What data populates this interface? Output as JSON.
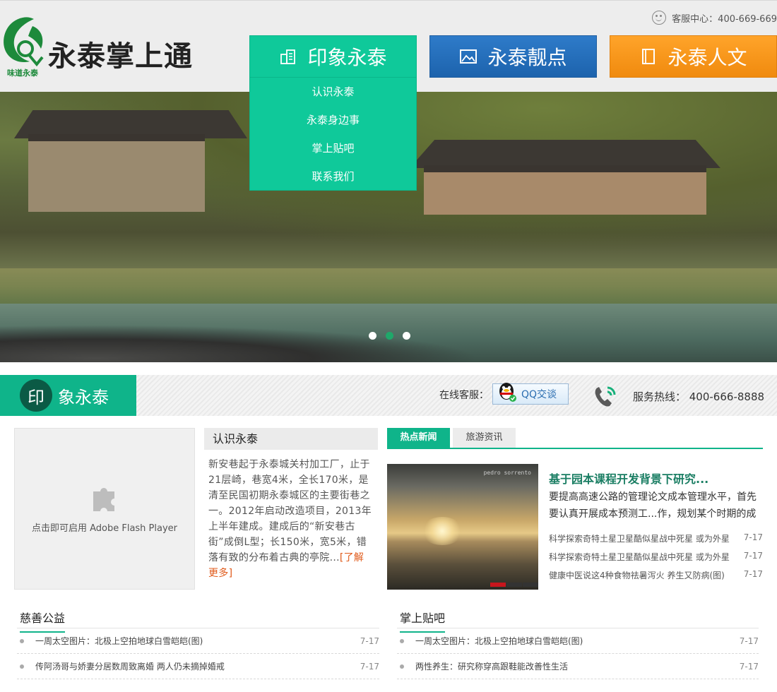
{
  "header": {
    "logo_text": "永泰掌上通",
    "logo_sub": "味道永泰",
    "service_label": "客服中心：400-669-669"
  },
  "nav": [
    {
      "label": "印象永泰",
      "icon": "building-icon",
      "color": "#0fc99a"
    },
    {
      "label": "永泰靓点",
      "icon": "picture-icon",
      "color": "#1d63ad"
    },
    {
      "label": "永泰人文",
      "icon": "book-icon",
      "color": "#f59a16"
    }
  ],
  "dropdown": [
    "认识永泰",
    "永泰身边事",
    "掌上贴吧",
    "联系我们"
  ],
  "banner": {
    "slides": 3,
    "active_index": 1
  },
  "section": {
    "badge": "印",
    "title": "象永泰",
    "online_label": "在线客服：",
    "qq_label": "QQ交谈",
    "hotline": "服务热线： 400-666-8888"
  },
  "flash": {
    "text": "点击即可启用 Adobe Flash Player"
  },
  "about": {
    "title": "认识永泰",
    "body": "新安巷起于永泰城关村加工厂，止于21层崎，巷宽4米，全长170米，是清至民国初期永泰城区的主要街巷之一。2012年启动改造项目，2013年上半年建成。建成后的“新安巷古街”成倒L型；长150米，宽5米，错落有致的分布着古典的亭院...",
    "more": "[了解更多]"
  },
  "news": {
    "tabs": [
      {
        "label": "热点新闻",
        "active": true
      },
      {
        "label": "旅游资讯",
        "active": false
      }
    ],
    "image_watermark": "pedro sorrento",
    "headline": "基于园本课程开发背景下研究...",
    "summary": "要提高高速公路的管理论文成本管理水平，首先要认真开展成本预测工...作，规划某个时期的成",
    "items": [
      {
        "title": "科学探索奇特土星卫星酷似星战中死星 或为外星",
        "date": "7-17"
      },
      {
        "title": "科学探索奇特土星卫星酷似星战中死星 或为外星",
        "date": "7-17"
      },
      {
        "title": "健康中医说这4种食物祛暑泻火 养生又防病(图)",
        "date": "7-17"
      }
    ]
  },
  "charity": {
    "title": "慈善公益",
    "items": [
      {
        "title": "一周太空图片：北极上空拍地球白雪皑皑(图)",
        "date": "7-17"
      },
      {
        "title": "传阿汤哥与娇妻分居数周致离婚 两人仍未摘掉婚戒",
        "date": "7-17"
      }
    ]
  },
  "forum": {
    "title": "掌上贴吧",
    "items": [
      {
        "title": "一周太空图片：北极上空拍地球白雪皑皑(图)",
        "date": "7-17"
      },
      {
        "title": "两性养生：研究称穿高跟鞋能改善性生活",
        "date": "7-17"
      }
    ]
  }
}
